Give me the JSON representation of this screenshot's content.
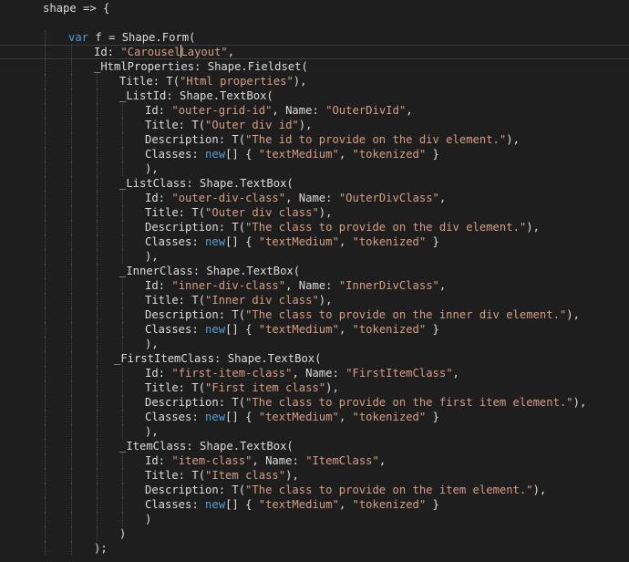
{
  "editor": {
    "colors": {
      "background": "#1e1e1e",
      "plain": "#dcdcdc",
      "keyword": "#569cd6",
      "string": "#d69d85",
      "guide": "#4a4a4a"
    },
    "caret": {
      "line": 3,
      "token": 1,
      "offset": 9
    },
    "lines": [
      {
        "indent": 1,
        "tokens": [
          {
            "t": "shape => {",
            "k": "pl"
          }
        ]
      },
      {
        "indent": 0,
        "tokens": []
      },
      {
        "indent": 2,
        "tokens": [
          {
            "t": "var",
            "k": "kw"
          },
          {
            "t": " f = Shape.Form(",
            "k": "pl"
          }
        ]
      },
      {
        "indent": 3,
        "current": true,
        "tokens": [
          {
            "t": "Id: ",
            "k": "pl"
          },
          {
            "t": "\"CarouselLayout\"",
            "k": "st"
          },
          {
            "t": ",",
            "k": "pl"
          }
        ]
      },
      {
        "indent": 3,
        "tokens": [
          {
            "t": "_HtmlProperties: Shape.Fieldset(",
            "k": "pl"
          }
        ]
      },
      {
        "indent": 4,
        "tokens": [
          {
            "t": "Title: T(",
            "k": "pl"
          },
          {
            "t": "\"Html properties\"",
            "k": "st"
          },
          {
            "t": "),",
            "k": "pl"
          }
        ]
      },
      {
        "indent": 4,
        "tokens": [
          {
            "t": "_ListId: Shape.TextBox(",
            "k": "pl"
          }
        ]
      },
      {
        "indent": 5,
        "tokens": [
          {
            "t": "Id: ",
            "k": "pl"
          },
          {
            "t": "\"outer-grid-id\"",
            "k": "st"
          },
          {
            "t": ", Name: ",
            "k": "pl"
          },
          {
            "t": "\"OuterDivId\"",
            "k": "st"
          },
          {
            "t": ",",
            "k": "pl"
          }
        ]
      },
      {
        "indent": 5,
        "tokens": [
          {
            "t": "Title: T(",
            "k": "pl"
          },
          {
            "t": "\"Outer div id\"",
            "k": "st"
          },
          {
            "t": "),",
            "k": "pl"
          }
        ]
      },
      {
        "indent": 5,
        "tokens": [
          {
            "t": "Description: T(",
            "k": "pl"
          },
          {
            "t": "\"The id to provide on the div element.\"",
            "k": "st"
          },
          {
            "t": "),",
            "k": "pl"
          }
        ]
      },
      {
        "indent": 5,
        "tokens": [
          {
            "t": "Classes: ",
            "k": "pl"
          },
          {
            "t": "new",
            "k": "kw"
          },
          {
            "t": "[] { ",
            "k": "pl"
          },
          {
            "t": "\"textMedium\"",
            "k": "st"
          },
          {
            "t": ", ",
            "k": "pl"
          },
          {
            "t": "\"tokenized\"",
            "k": "st"
          },
          {
            "t": " }",
            "k": "pl"
          }
        ]
      },
      {
        "indent": 5,
        "tokens": [
          {
            "t": "),",
            "k": "pl"
          }
        ]
      },
      {
        "indent": 4,
        "tokens": [
          {
            "t": "_ListClass: Shape.TextBox(",
            "k": "pl"
          }
        ]
      },
      {
        "indent": 5,
        "tokens": [
          {
            "t": "Id: ",
            "k": "pl"
          },
          {
            "t": "\"outer-div-class\"",
            "k": "st"
          },
          {
            "t": ", Name: ",
            "k": "pl"
          },
          {
            "t": "\"OuterDivClass\"",
            "k": "st"
          },
          {
            "t": ",",
            "k": "pl"
          }
        ]
      },
      {
        "indent": 5,
        "tokens": [
          {
            "t": "Title: T(",
            "k": "pl"
          },
          {
            "t": "\"Outer div class\"",
            "k": "st"
          },
          {
            "t": "),",
            "k": "pl"
          }
        ]
      },
      {
        "indent": 5,
        "tokens": [
          {
            "t": "Description: T(",
            "k": "pl"
          },
          {
            "t": "\"The class to provide on the div element.\"",
            "k": "st"
          },
          {
            "t": "),",
            "k": "pl"
          }
        ]
      },
      {
        "indent": 5,
        "tokens": [
          {
            "t": "Classes: ",
            "k": "pl"
          },
          {
            "t": "new",
            "k": "kw"
          },
          {
            "t": "[] { ",
            "k": "pl"
          },
          {
            "t": "\"textMedium\"",
            "k": "st"
          },
          {
            "t": ", ",
            "k": "pl"
          },
          {
            "t": "\"tokenized\"",
            "k": "st"
          },
          {
            "t": " }",
            "k": "pl"
          }
        ]
      },
      {
        "indent": 5,
        "tokens": [
          {
            "t": "),",
            "k": "pl"
          }
        ]
      },
      {
        "indent": 4,
        "tokens": [
          {
            "t": "_InnerClass: Shape.TextBox(",
            "k": "pl"
          }
        ]
      },
      {
        "indent": 5,
        "tokens": [
          {
            "t": "Id: ",
            "k": "pl"
          },
          {
            "t": "\"inner-div-class\"",
            "k": "st"
          },
          {
            "t": ", Name: ",
            "k": "pl"
          },
          {
            "t": "\"InnerDivClass\"",
            "k": "st"
          },
          {
            "t": ",",
            "k": "pl"
          }
        ]
      },
      {
        "indent": 5,
        "tokens": [
          {
            "t": "Title: T(",
            "k": "pl"
          },
          {
            "t": "\"Inner div class\"",
            "k": "st"
          },
          {
            "t": "),",
            "k": "pl"
          }
        ]
      },
      {
        "indent": 5,
        "tokens": [
          {
            "t": "Description: T(",
            "k": "pl"
          },
          {
            "t": "\"The class to provide on the inner div element.\"",
            "k": "st"
          },
          {
            "t": "),",
            "k": "pl"
          }
        ]
      },
      {
        "indent": 5,
        "tokens": [
          {
            "t": "Classes: ",
            "k": "pl"
          },
          {
            "t": "new",
            "k": "kw"
          },
          {
            "t": "[] { ",
            "k": "pl"
          },
          {
            "t": "\"textMedium\"",
            "k": "st"
          },
          {
            "t": ", ",
            "k": "pl"
          },
          {
            "t": "\"tokenized\"",
            "k": "st"
          },
          {
            "t": " }",
            "k": "pl"
          }
        ]
      },
      {
        "indent": 5,
        "tokens": [
          {
            "t": "),",
            "k": "pl"
          }
        ]
      },
      {
        "indent": 4,
        "shift": -1,
        "tokens": [
          {
            "t": "_FirstItemClass: Shape.TextBox(",
            "k": "pl"
          }
        ]
      },
      {
        "indent": 5,
        "tokens": [
          {
            "t": "Id: ",
            "k": "pl"
          },
          {
            "t": "\"first-item-class\"",
            "k": "st"
          },
          {
            "t": ", Name: ",
            "k": "pl"
          },
          {
            "t": "\"FirstItemClass\"",
            "k": "st"
          },
          {
            "t": ",",
            "k": "pl"
          }
        ]
      },
      {
        "indent": 5,
        "tokens": [
          {
            "t": "Title: T(",
            "k": "pl"
          },
          {
            "t": "\"First item class\"",
            "k": "st"
          },
          {
            "t": "),",
            "k": "pl"
          }
        ]
      },
      {
        "indent": 5,
        "tokens": [
          {
            "t": "Description: T(",
            "k": "pl"
          },
          {
            "t": "\"The class to provide on the first item element.\"",
            "k": "st"
          },
          {
            "t": "),",
            "k": "pl"
          }
        ]
      },
      {
        "indent": 5,
        "tokens": [
          {
            "t": "Classes: ",
            "k": "pl"
          },
          {
            "t": "new",
            "k": "kw"
          },
          {
            "t": "[] { ",
            "k": "pl"
          },
          {
            "t": "\"textMedium\"",
            "k": "st"
          },
          {
            "t": ", ",
            "k": "pl"
          },
          {
            "t": "\"tokenized\"",
            "k": "st"
          },
          {
            "t": " }",
            "k": "pl"
          }
        ]
      },
      {
        "indent": 5,
        "tokens": [
          {
            "t": "),",
            "k": "pl"
          }
        ]
      },
      {
        "indent": 4,
        "tokens": [
          {
            "t": "_ItemClass: Shape.TextBox(",
            "k": "pl"
          }
        ]
      },
      {
        "indent": 5,
        "tokens": [
          {
            "t": "Id: ",
            "k": "pl"
          },
          {
            "t": "\"item-class\"",
            "k": "st"
          },
          {
            "t": ", Name: ",
            "k": "pl"
          },
          {
            "t": "\"ItemClass\"",
            "k": "st"
          },
          {
            "t": ",",
            "k": "pl"
          }
        ]
      },
      {
        "indent": 5,
        "tokens": [
          {
            "t": "Title: T(",
            "k": "pl"
          },
          {
            "t": "\"Item class\"",
            "k": "st"
          },
          {
            "t": "),",
            "k": "pl"
          }
        ]
      },
      {
        "indent": 5,
        "tokens": [
          {
            "t": "Description: T(",
            "k": "pl"
          },
          {
            "t": "\"The class to provide on the item element.\"",
            "k": "st"
          },
          {
            "t": "),",
            "k": "pl"
          }
        ]
      },
      {
        "indent": 5,
        "tokens": [
          {
            "t": "Classes: ",
            "k": "pl"
          },
          {
            "t": "new",
            "k": "kw"
          },
          {
            "t": "[] { ",
            "k": "pl"
          },
          {
            "t": "\"textMedium\"",
            "k": "st"
          },
          {
            "t": ", ",
            "k": "pl"
          },
          {
            "t": "\"tokenized\"",
            "k": "st"
          },
          {
            "t": " }",
            "k": "pl"
          }
        ]
      },
      {
        "indent": 5,
        "tokens": [
          {
            "t": ")",
            "k": "pl"
          }
        ]
      },
      {
        "indent": 4,
        "tokens": [
          {
            "t": ")",
            "k": "pl"
          }
        ]
      },
      {
        "indent": 3,
        "tokens": [
          {
            "t": ");",
            "k": "pl"
          }
        ]
      }
    ]
  }
}
